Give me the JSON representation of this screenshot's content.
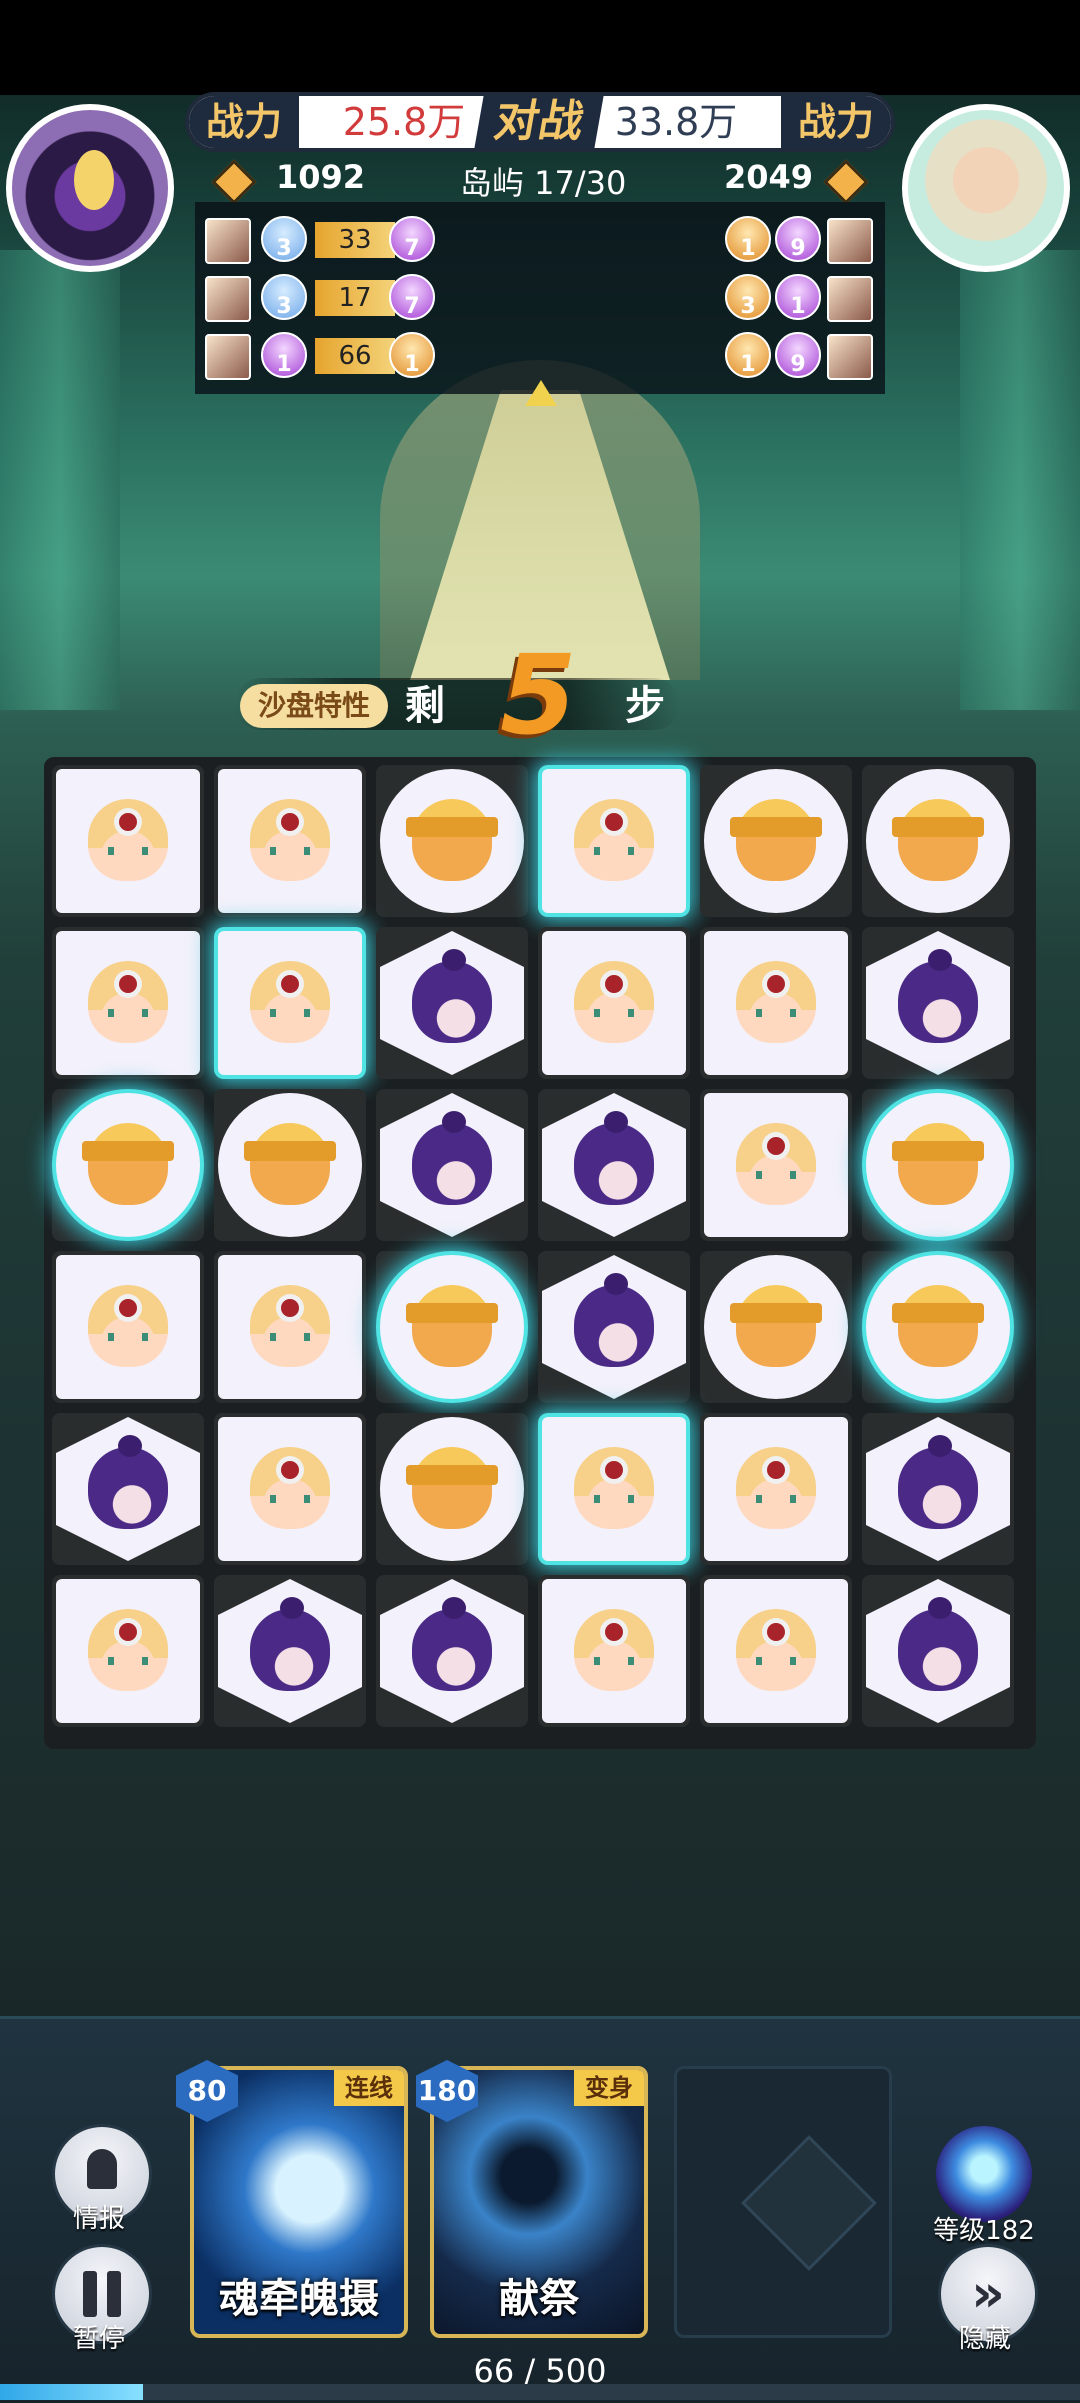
{
  "header": {
    "left_power_tag": "战力",
    "left_power_value": "25.8万",
    "battle_label": "对战",
    "right_power_value": "33.8万",
    "right_power_tag": "战力",
    "left_score": "1092",
    "stage_label": "岛屿 17/30",
    "right_score": "2049"
  },
  "left_team": [
    {
      "orb1": "3",
      "bar": "33",
      "orb2": "7"
    },
    {
      "orb1": "3",
      "bar": "17",
      "orb2": "7"
    },
    {
      "orb1": "1",
      "bar": "66",
      "orb2": "1"
    }
  ],
  "right_team": [
    {
      "orb1": "1",
      "orb2": "9"
    },
    {
      "orb1": "3",
      "orb2": "1"
    },
    {
      "orb1": "1",
      "orb2": "9"
    }
  ],
  "steps": {
    "feature_label": "沙盘特性",
    "prefix": "剩",
    "count": "5",
    "suffix": "步"
  },
  "board": [
    [
      "cleric-square",
      "cleric-square",
      "warrior-circle",
      "cleric-square",
      "warrior-circle",
      "warrior-circle"
    ],
    [
      "cleric-square",
      "cleric-square",
      "mage-hex",
      "cleric-square",
      "cleric-square",
      "mage-hex"
    ],
    [
      "warrior-circle",
      "warrior-circle",
      "mage-hex",
      "mage-hex",
      "cleric-square",
      "warrior-circle"
    ],
    [
      "cleric-square",
      "cleric-square",
      "warrior-circle",
      "mage-hex",
      "warrior-circle",
      "warrior-circle"
    ],
    [
      "mage-hex",
      "cleric-square",
      "warrior-circle",
      "cleric-square",
      "cleric-square",
      "mage-hex"
    ],
    [
      "cleric-square",
      "mage-hex",
      "mage-hex",
      "cleric-square",
      "cleric-square",
      "mage-hex"
    ]
  ],
  "glowing_tiles": [
    "0-3",
    "1-1",
    "2-0",
    "2-5",
    "3-2",
    "3-5",
    "4-3"
  ],
  "bottom": {
    "info_label": "情报",
    "pause_label": "暂停",
    "skill1": {
      "cost": "80",
      "tag": "连线",
      "name": "魂牵魄摄"
    },
    "skill2": {
      "cost": "180",
      "tag": "变身",
      "name": "献祭"
    },
    "level_label": "等级182",
    "hide_label": "隐藏",
    "progress_text": "66 / 500",
    "progress_fraction": 0.132
  },
  "colors": {
    "accent_gold": "#f4c66a",
    "power_red": "#d23b3b",
    "glow_cyan": "#4fe3e3"
  }
}
